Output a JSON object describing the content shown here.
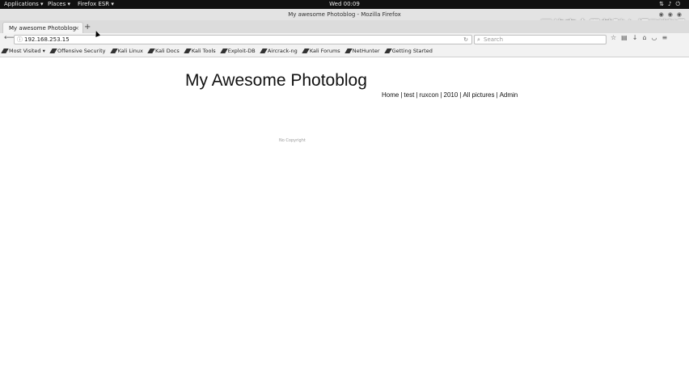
{
  "system_bar": {
    "applications": "Applications ▾",
    "places": "Places ▾",
    "firefox": "Firefox ESR ▾",
    "clock": "Wed 00:09"
  },
  "window": {
    "title": "My awesome Photoblog - Mozilla Firefox",
    "watermark": "网络安全零基础入门到精通"
  },
  "tab": {
    "title": "My awesome Photoblog",
    "close": "×",
    "new_tab": "+"
  },
  "navbar": {
    "url": "192.168.253.15",
    "search_placeholder": "Search"
  },
  "bookmarks": [
    "Most Visited ▾",
    "Offensive Security",
    "Kali Linux",
    "Kali Docs",
    "Kali Tools",
    "Exploit-DB",
    "Aircrack-ng",
    "Kali Forums",
    "NetHunter",
    "Getting Started"
  ],
  "page": {
    "title": "My Awesome Photoblog",
    "nav": [
      "Home",
      "test",
      "ruxcon",
      "2010",
      "All pictures",
      "Admin"
    ],
    "footer": "No Copyright"
  }
}
